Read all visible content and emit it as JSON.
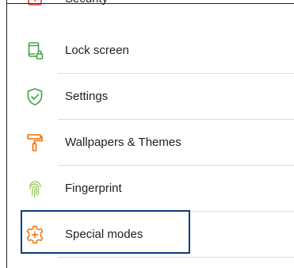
{
  "settings_list": {
    "items": [
      {
        "id": "security",
        "label": "Security",
        "icon": "security-icon",
        "icon_color": "#e53935"
      },
      {
        "id": "lock-screen",
        "label": "Lock screen",
        "icon": "phone-lock-icon",
        "icon_color": "#43a047"
      },
      {
        "id": "settings",
        "label": "Settings",
        "icon": "shield-check-icon",
        "icon_color": "#43a047"
      },
      {
        "id": "wallpapers-themes",
        "label": "Wallpapers & Themes",
        "icon": "paint-roller-icon",
        "icon_color": "#ef6c00"
      },
      {
        "id": "fingerprint",
        "label": "Fingerprint",
        "icon": "fingerprint-icon",
        "icon_color": "#9ccc65"
      },
      {
        "id": "special-modes",
        "label": "Special modes",
        "icon": "gear-plus-icon",
        "icon_color": "#ef6c00"
      }
    ],
    "highlighted_item": "special-modes",
    "highlight_color": "#0b3e7a"
  }
}
